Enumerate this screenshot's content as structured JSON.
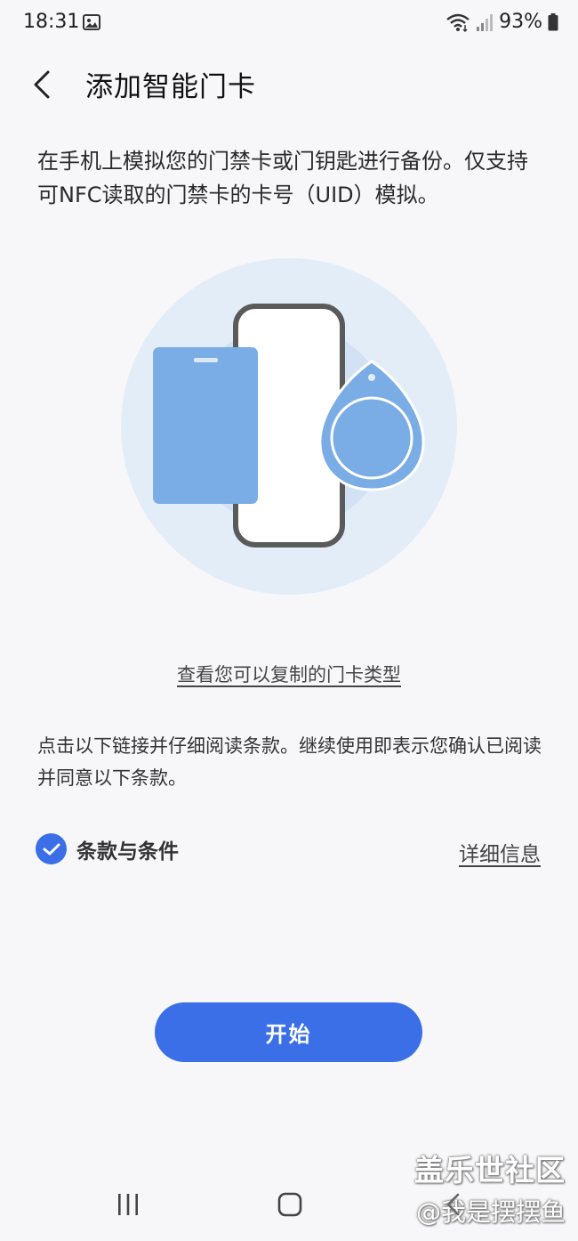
{
  "status_bar": {
    "time": "18:31",
    "battery": "93%",
    "icons": [
      "photo-icon",
      "wifi-icon",
      "signal-icon",
      "battery-icon"
    ]
  },
  "header": {
    "title": "添加智能门卡",
    "back_icon": "chevron-left-icon"
  },
  "description": {
    "text": "在手机上模拟您的门禁卡或门钥匙进行备份。仅支持可NFC读取的门禁卡的卡号（UID）模拟。"
  },
  "illustration": {
    "icons": [
      "card-icon",
      "phone-icon",
      "key-fob-icon"
    ],
    "colors": {
      "outer_circle": "#e3edf8",
      "inner_circle": "#cfe0f3",
      "card": "#7aace6",
      "phone_frame": "#5a5a5a",
      "fob": "#7aace6"
    }
  },
  "links": {
    "card_types": "查看您可以复制的门卡类型"
  },
  "terms": {
    "note": "点击以下链接并仔细阅读条款。继续使用即表示您确认已阅读并同意以下条款。",
    "label": "条款与条件",
    "checked": true,
    "details": "详细信息"
  },
  "actions": {
    "start_label": "开始"
  },
  "watermark": {
    "line1": "盖乐世社区",
    "line2": "@我是摆摆鱼"
  },
  "nav_bar": {
    "icons": [
      "recents-icon",
      "home-icon",
      "back-icon"
    ]
  },
  "colors": {
    "accent": "#3a6fe8",
    "background": "#f7f7f9"
  }
}
